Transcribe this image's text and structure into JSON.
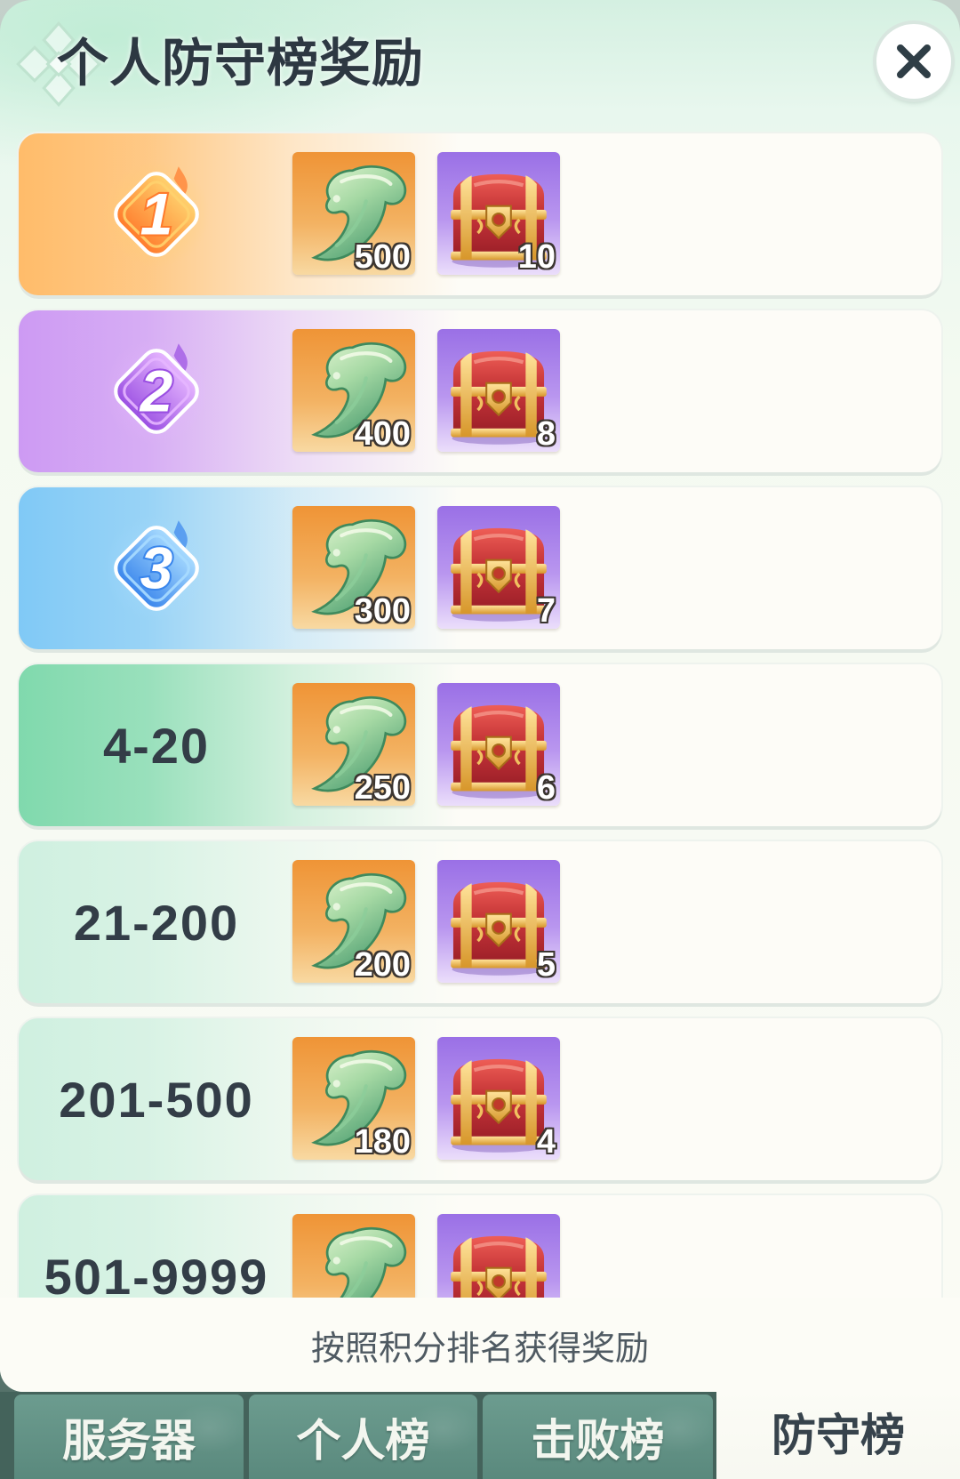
{
  "title": "个人防守榜奖励",
  "title_icon": "diamond-emblem-icon",
  "close_icon": "close-icon",
  "rewards": [
    {
      "rank": "1",
      "badge": true,
      "badge_light": "#ffd26e",
      "badge_dark": "#ff7b2c",
      "row_color": "#ffbc6a",
      "items": [
        {
          "icon": "jade-feather-icon",
          "count": "500"
        },
        {
          "icon": "treasure-chest-icon",
          "count": "10"
        }
      ]
    },
    {
      "rank": "2",
      "badge": true,
      "badge_light": "#e6b6ff",
      "badge_dark": "#9a4fe2",
      "row_color": "#cd9af3",
      "items": [
        {
          "icon": "jade-feather-icon",
          "count": "400"
        },
        {
          "icon": "treasure-chest-icon",
          "count": "8"
        }
      ]
    },
    {
      "rank": "3",
      "badge": true,
      "badge_light": "#a9dcff",
      "badge_dark": "#3a86ec",
      "row_color": "#80c9f6",
      "items": [
        {
          "icon": "jade-feather-icon",
          "count": "300"
        },
        {
          "icon": "treasure-chest-icon",
          "count": "7"
        }
      ]
    },
    {
      "rank": "4-20",
      "badge": false,
      "row_color": "#80d9ad",
      "items": [
        {
          "icon": "jade-feather-icon",
          "count": "250"
        },
        {
          "icon": "treasure-chest-icon",
          "count": "6"
        }
      ]
    },
    {
      "rank": "21-200",
      "badge": false,
      "row_color": "#cff0e0",
      "items": [
        {
          "icon": "jade-feather-icon",
          "count": "200"
        },
        {
          "icon": "treasure-chest-icon",
          "count": "5"
        }
      ]
    },
    {
      "rank": "201-500",
      "badge": false,
      "row_color": "#cff0e0",
      "items": [
        {
          "icon": "jade-feather-icon",
          "count": "180"
        },
        {
          "icon": "treasure-chest-icon",
          "count": "4"
        }
      ]
    },
    {
      "rank": "501-9999",
      "badge": false,
      "row_color": "#cff0e0",
      "items": [
        {
          "icon": "jade-feather-icon"
        },
        {
          "icon": "treasure-chest-icon"
        }
      ]
    }
  ],
  "footer_note": "按照积分排名获得奖励",
  "tabs": [
    {
      "label": "服务器",
      "active": false
    },
    {
      "label": "个人榜",
      "active": false
    },
    {
      "label": "击败榜",
      "active": false
    },
    {
      "label": "防守榜",
      "active": true
    }
  ],
  "colors": {
    "tab_bar": "#5a897d",
    "tab_active": "#fcfcf6",
    "rank_text": "#333d47",
    "jade_item_bg": "#ef9436",
    "chest_item_bg": "#9a70e6"
  }
}
